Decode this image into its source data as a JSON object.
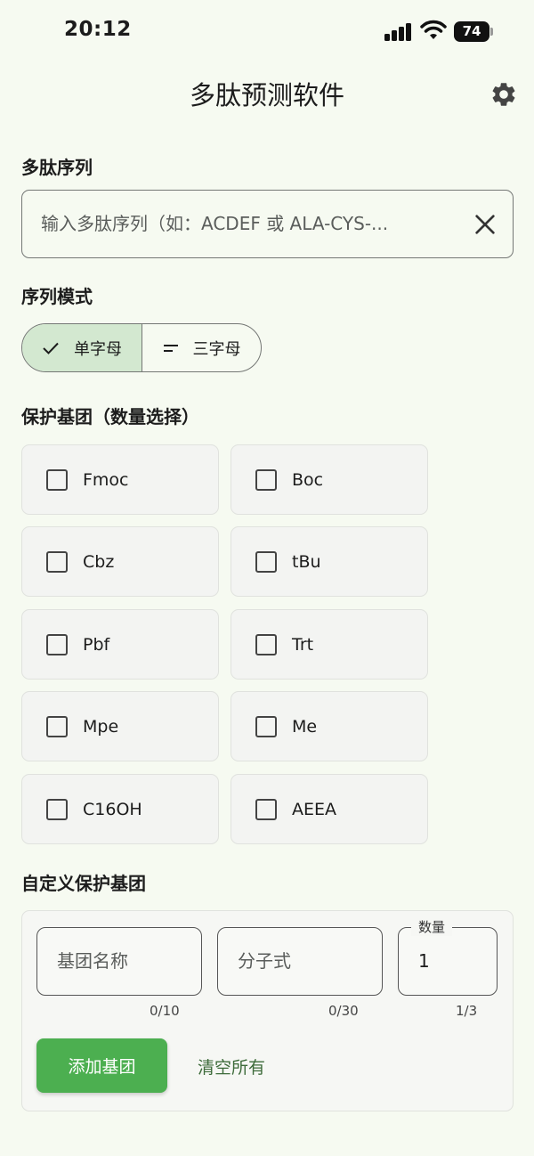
{
  "status": {
    "time": "20:12",
    "battery": "74"
  },
  "app": {
    "title": "多肽预测软件"
  },
  "sequence": {
    "label": "多肽序列",
    "placeholder": "输入多肽序列（如：ACDEF 或 ALA-CYS-..."
  },
  "mode": {
    "label": "序列模式",
    "options": [
      "单字母",
      "三字母"
    ],
    "selected": "单字母"
  },
  "protecting_groups": {
    "label": "保护基团（数量选择）",
    "items": [
      "Fmoc",
      "Boc",
      "Cbz",
      "tBu",
      "Pbf",
      "Trt",
      "Mpe",
      "Me",
      "C16OH",
      "AEEA"
    ]
  },
  "custom": {
    "label": "自定义保护基团",
    "name_placeholder": "基团名称",
    "name_counter": "0/10",
    "formula_placeholder": "分子式",
    "formula_counter": "0/30",
    "quantity_label": "数量",
    "quantity_value": "1",
    "quantity_counter": "1/3",
    "add_label": "添加基团",
    "clear_label": "清空所有"
  }
}
